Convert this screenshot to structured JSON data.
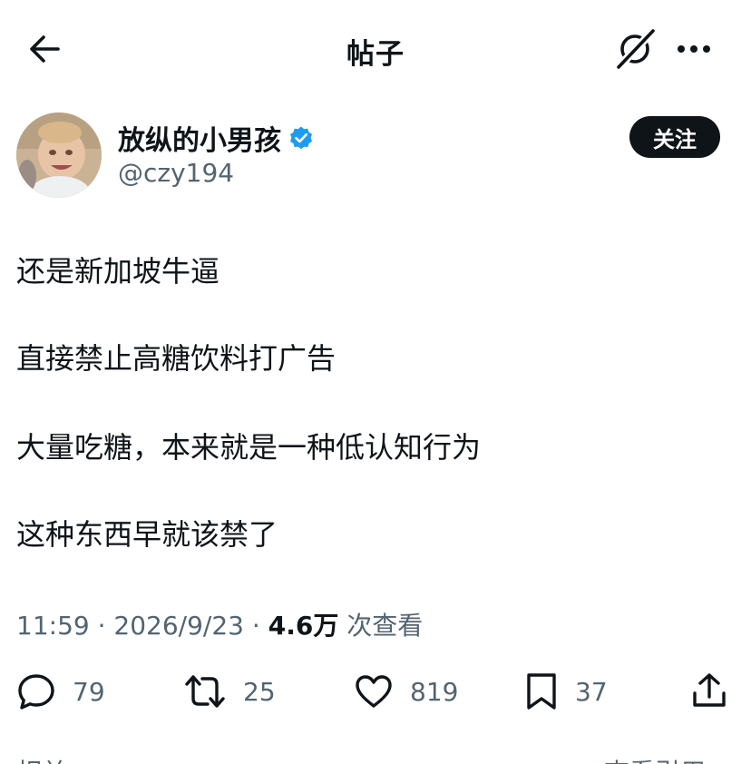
{
  "header": {
    "title": "帖子",
    "back_icon": "arrow-left-icon",
    "grok_icon": "grok-icon",
    "more_icon": "more-horizontal-icon"
  },
  "author": {
    "display_name": "放纵的小男孩",
    "handle": "@czy194",
    "verified": true,
    "verified_color": "#1d9bf0",
    "follow_label": "关注"
  },
  "post": {
    "lines": [
      "还是新加坡牛逼",
      "直接禁止高糖饮料打广告",
      "大量吃糖，本来就是一种低认知行为",
      "这种东西早就该禁了"
    ],
    "time": "11:59",
    "date": "2026/9/23",
    "views": "4.6万",
    "views_label": "次查看"
  },
  "actions": {
    "replies": "79",
    "reposts": "25",
    "likes": "819",
    "bookmarks": "37"
  },
  "footer": {
    "left_partial": "相关",
    "right_partial": "查看引用"
  },
  "colors": {
    "text_primary": "#0f1419",
    "text_secondary": "#536471",
    "accent": "#1d9bf0"
  }
}
